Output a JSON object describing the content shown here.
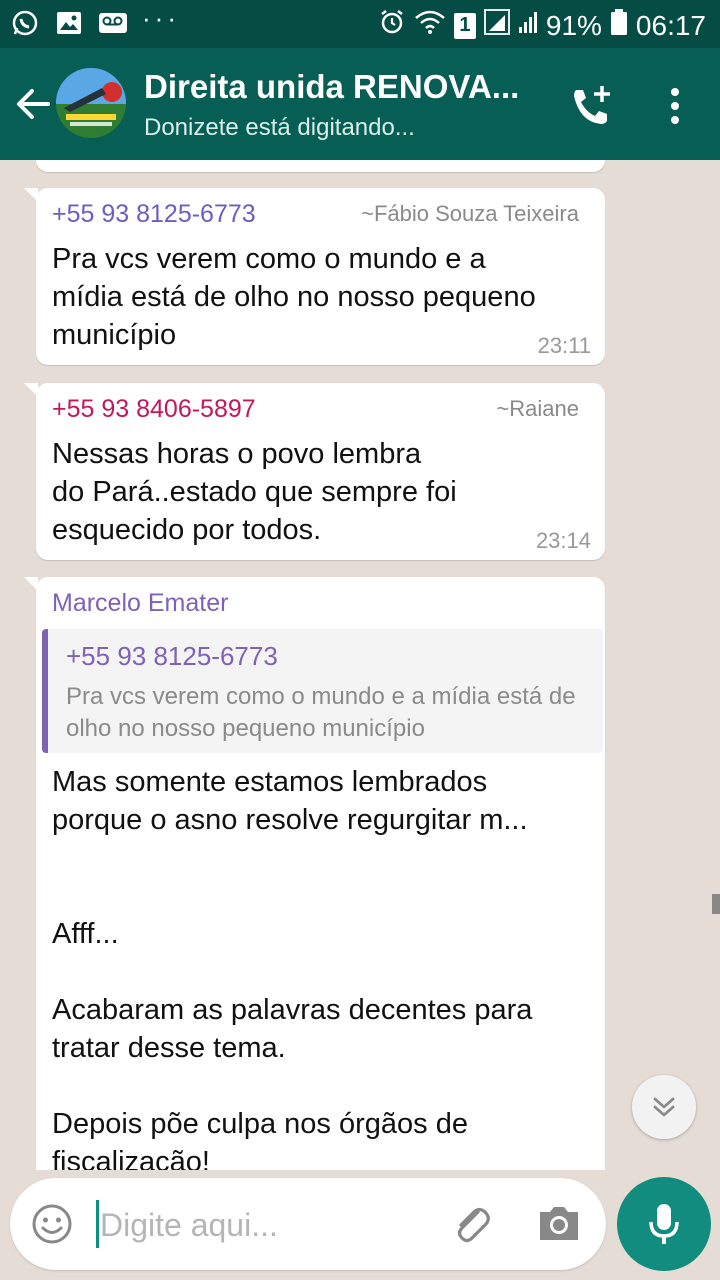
{
  "status_bar": {
    "sim_badge": "1",
    "battery": "91%",
    "time": "06:17",
    "left_icons": [
      "whatsapp-icon",
      "image-icon",
      "voicemail-icon"
    ]
  },
  "header": {
    "title": "Direita unida RENOVA...",
    "subtitle": "Donizete está digitando..."
  },
  "messages": [
    {
      "sender": "+55 93 8125-6773",
      "sender_color": "#6a5ec4",
      "alias": "~Fábio Souza Teixeira",
      "text": "Pra vcs verem como o mundo e a\nmídia está de olho no nosso pequeno\nmunicípio",
      "time": "23:11"
    },
    {
      "sender": "+55 93 8406-5897",
      "sender_color": "#c2185b",
      "alias": "~Raiane",
      "text": "Nessas horas o povo lembra\ndo Pará..estado que sempre foi\nesquecido por todos.",
      "time": "23:14"
    },
    {
      "sender": "Marcelo Emater",
      "sender_color": "#7e62b3",
      "quote": {
        "sender": "+55 93 8125-6773",
        "text": "Pra vcs verem como o mundo e a mídia está de olho no nosso pequeno município"
      },
      "text": "Mas somente estamos lembrados\nporque o asno resolve regurgitar m...\n\n\nAfff...\n\nAcabaram as palavras decentes para\ntratar desse tema.\n\nDepois põe culpa nos órgãos de\nfiscalização!"
    }
  ],
  "composer": {
    "placeholder": "Digite aqui..."
  },
  "colors": {
    "header": "#075e54",
    "status_bar": "#054d44",
    "chat_background": "#e5ddd5",
    "mic_button": "#128c7e",
    "quote_bar": "#7e62b3"
  }
}
